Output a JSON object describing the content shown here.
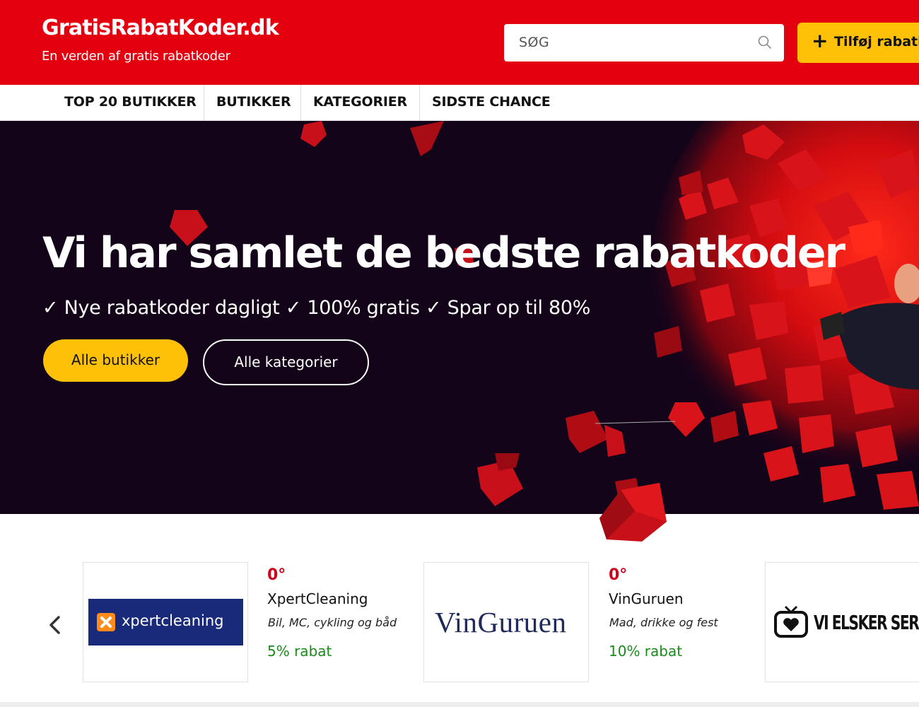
{
  "header": {
    "logo_title": "GratisRabatKoder.dk",
    "logo_subtitle": "En verden af gratis rabatkoder",
    "search_placeholder": "SØG",
    "add_button_plus": "+",
    "add_button_label": "Tilføj rabatkode",
    "brand_color": "#e3000f",
    "accent_color": "#ffc107"
  },
  "nav": {
    "items": [
      "TOP 20 BUTIKKER",
      "BUTIKKER",
      "KATEGORIER",
      "SIDSTE CHANCE"
    ]
  },
  "hero": {
    "title": "Vi har samlet de bedste rabatkoder",
    "subtitle": "✓ Nye rabatkoder dagligt ✓ 100% gratis ✓ Spar op til 80%",
    "primary_button": "Alle butikker",
    "secondary_button": "Alle kategorier",
    "background_color": "#13041a"
  },
  "deals": [
    {
      "logo_text": "xpertcleaning",
      "degrees": "0°",
      "name": "XpertCleaning",
      "category": "Bil, MC, cykling og båd",
      "discount": "5% rabat"
    },
    {
      "logo_text": "VinGuruen",
      "degrees": "0°",
      "name": "VinGuruen",
      "category": "Mad, drikke og fest",
      "discount": "10% rabat"
    },
    {
      "logo_text": "VI ELSKER SERIER"
    }
  ],
  "icons": {
    "search": "search-icon",
    "prev": "chevron-left-icon",
    "plus": "plus-icon"
  }
}
